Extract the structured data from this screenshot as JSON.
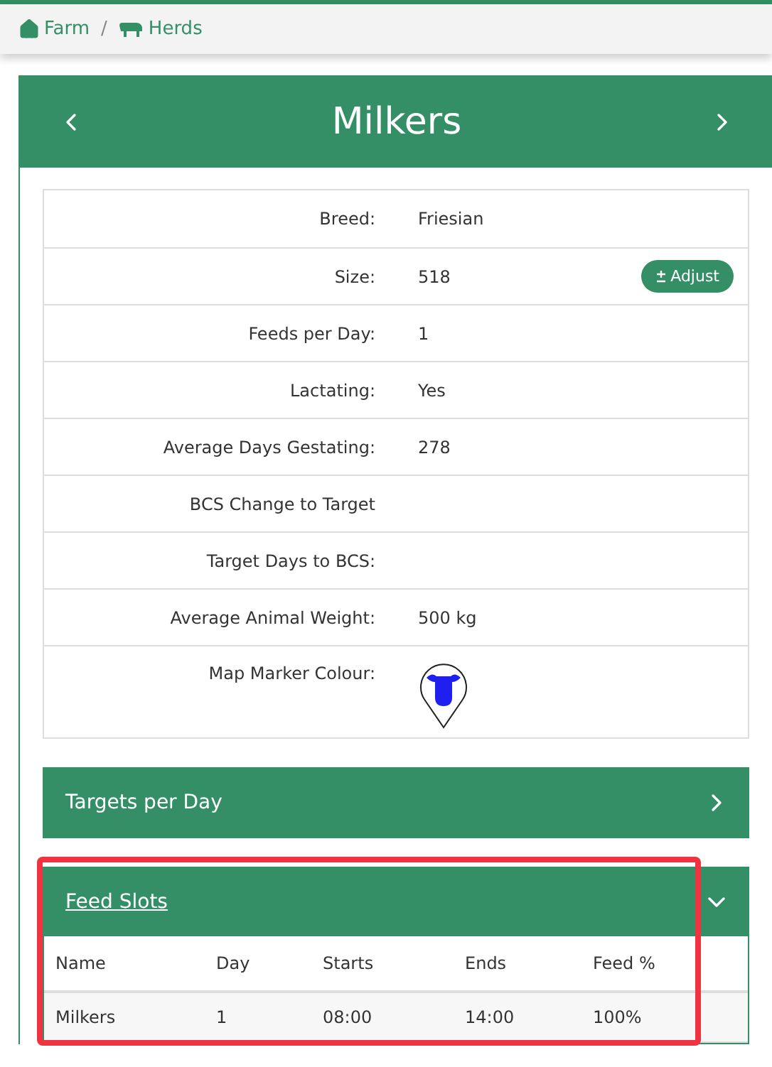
{
  "breadcrumb": [
    {
      "label": "Farm"
    },
    {
      "label": "Herds"
    }
  ],
  "breadcrumb_separator": "/",
  "herd": {
    "title": "Milkers"
  },
  "details": [
    {
      "kind": "text",
      "label": "Breed:",
      "value": "Friesian"
    },
    {
      "kind": "button",
      "label": "Size:",
      "value": "518",
      "button": "Adjust"
    },
    {
      "kind": "text",
      "label": "Feeds per Day:",
      "value": "1"
    },
    {
      "kind": "text",
      "label": "Lactating:",
      "value": "Yes"
    },
    {
      "kind": "text",
      "label": "Average Days Gestating:",
      "value": "278"
    },
    {
      "kind": "text",
      "label": "BCS Change to Target"
    },
    {
      "kind": "text",
      "label": "Target Days to BCS:"
    },
    {
      "kind": "text",
      "label": "Average Animal Weight:",
      "value": "500 kg"
    },
    {
      "kind": "marker",
      "label": "Map Marker Colour:",
      "color": "#1f1fef"
    }
  ],
  "sections": [
    {
      "title": "Targets per Day",
      "expanded": false,
      "link": false
    },
    {
      "title": "Feed Slots",
      "expanded": true,
      "link": true,
      "highlighted": true,
      "columns": [
        "Name",
        "Day",
        "Starts",
        "Ends",
        "Feed %"
      ],
      "rows": [
        [
          "Milkers",
          "1",
          "08:00",
          "14:00",
          "100%"
        ]
      ]
    }
  ]
}
